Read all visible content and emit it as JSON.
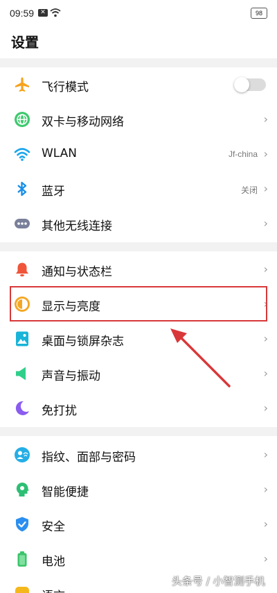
{
  "status_bar": {
    "time": "09:59",
    "battery": "98"
  },
  "header": {
    "title": "设置"
  },
  "groups": [
    {
      "items": [
        {
          "label": "飞行模式",
          "icon": "airplane-icon",
          "control": "toggle",
          "on": false
        },
        {
          "label": "双卡与移动网络",
          "icon": "globe-icon"
        },
        {
          "label": "WLAN",
          "icon": "wifi-icon",
          "value": "Jf-china"
        },
        {
          "label": "蓝牙",
          "icon": "bluetooth-icon",
          "value": "关闭"
        },
        {
          "label": "其他无线连接",
          "icon": "more-connections-icon"
        }
      ]
    },
    {
      "items": [
        {
          "label": "通知与状态栏",
          "icon": "bell-icon"
        },
        {
          "label": "显示与亮度",
          "icon": "brightness-icon"
        },
        {
          "label": "桌面与锁屏杂志",
          "icon": "wallpaper-icon"
        },
        {
          "label": "声音与振动",
          "icon": "speaker-icon"
        },
        {
          "label": "免打扰",
          "icon": "moon-icon"
        }
      ]
    },
    {
      "items": [
        {
          "label": "指纹、面部与密码",
          "icon": "fingerprint-icon"
        },
        {
          "label": "智能便捷",
          "icon": "smart-assist-icon"
        },
        {
          "label": "安全",
          "icon": "shield-icon"
        },
        {
          "label": "电池",
          "icon": "battery-icon"
        },
        {
          "label": "语言",
          "icon": "language-icon"
        }
      ]
    }
  ],
  "annotation": {
    "highlight_color": "#d9383a"
  },
  "watermark": "头条号 / 小智测手机"
}
